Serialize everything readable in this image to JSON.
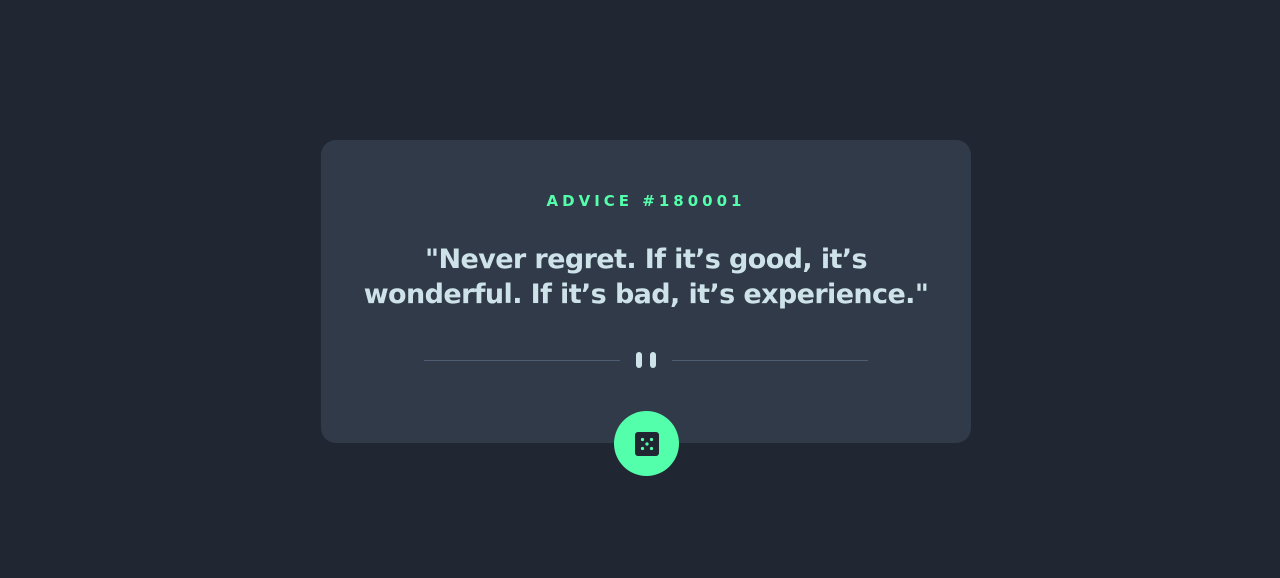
{
  "advice": {
    "label": "ADVICE #180001",
    "quote": "\"Never regret. If it’s good, it’s wonderful. If it’s bad, it’s experience.\""
  },
  "icons": {
    "divider": "pause-icon",
    "button": "dice-icon"
  },
  "colors": {
    "background": "#202632",
    "card": "#313a49",
    "accent": "#53ffab",
    "text": "#cee3e9",
    "divider": "#4f5d74"
  }
}
